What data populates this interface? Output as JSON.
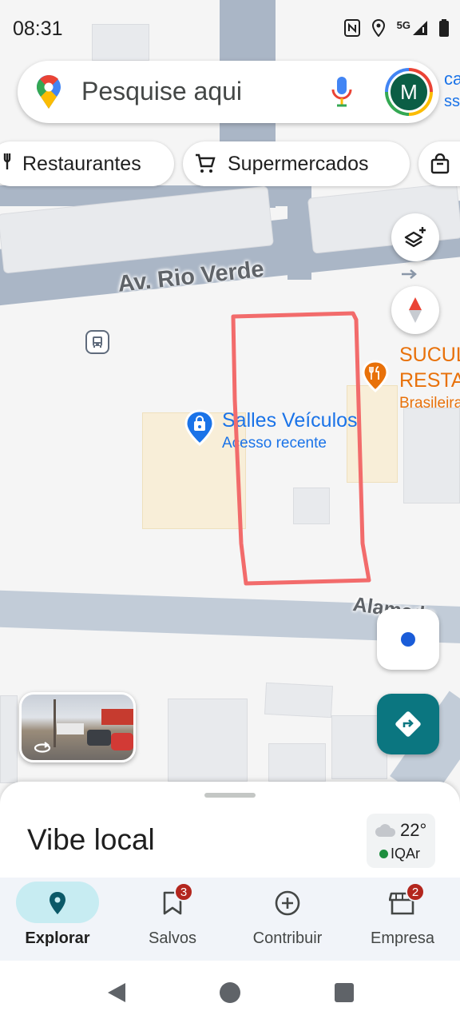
{
  "status_bar": {
    "time": "08:31",
    "network": "5G",
    "icons": [
      "nfc-icon",
      "location-icon",
      "signal-icon",
      "battery-icon"
    ]
  },
  "search": {
    "placeholder": "Pesquise aqui",
    "avatar_letter": "M",
    "icons": [
      "google-maps-pin-icon",
      "microphone-icon"
    ]
  },
  "chips": [
    {
      "label": "Restaurantes",
      "icon": "fork-knife-icon"
    },
    {
      "label": "Supermercados",
      "icon": "cart-icon"
    },
    {
      "label": "",
      "icon": "shopping-bag-icon"
    }
  ],
  "map": {
    "street_names": [
      "Av. Rio Verde",
      "Alameda"
    ],
    "peek_text": [
      "ca",
      "ssi"
    ],
    "places": [
      {
        "name": "Salles Veículos",
        "subtitle": "Acesso recente",
        "icon": "shopping-bag-icon"
      },
      {
        "name_lines": [
          "SUCUL",
          "RESTA"
        ],
        "category": "Brasileira",
        "icon": "restaurant-icon"
      }
    ],
    "markup_color": "#f26b6b"
  },
  "sheet": {
    "title": "Vibe local",
    "weather": {
      "temperature": "22°",
      "air_quality": "IQAr"
    }
  },
  "nav": [
    {
      "label": "Explorar",
      "icon": "explore-pin-icon",
      "active": true
    },
    {
      "label": "Salvos",
      "icon": "bookmark-icon",
      "badge": "3"
    },
    {
      "label": "Contribuir",
      "icon": "add-circle-icon"
    },
    {
      "label": "Empresa",
      "icon": "store-icon",
      "badge": "2"
    }
  ],
  "colors": {
    "accent_teal": "#0b7680",
    "place_blue": "#1a73e8",
    "restaurant_orange": "#e8710a",
    "badge_red": "#b3261e",
    "road": "#aab6c6"
  }
}
